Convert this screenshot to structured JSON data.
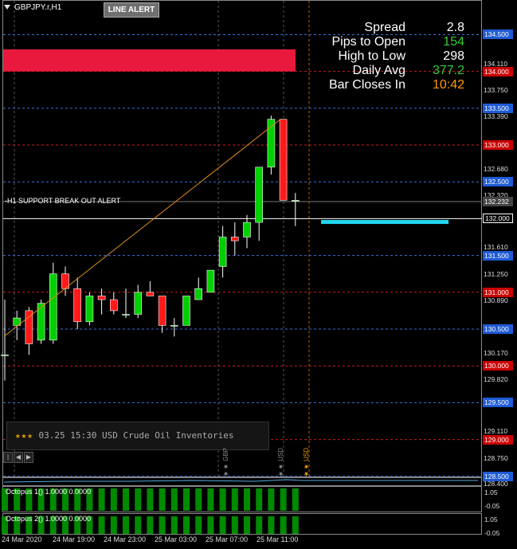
{
  "window": {
    "title": "GBPJPY.r,H1"
  },
  "toolbar": {
    "line_alert_label": "LINE ALERT"
  },
  "hud": {
    "rows": [
      {
        "label": "Spread",
        "value": "2.8",
        "color": "#ffffff"
      },
      {
        "label": "Pips to Open",
        "value": "154",
        "color": "#33cc33"
      },
      {
        "label": "High to Low",
        "value": "298",
        "color": "#ffffff"
      },
      {
        "label": "Daily Avg",
        "value": "377.2",
        "color": "#33cc33"
      },
      {
        "label": "Bar Closes In",
        "value": "10:42",
        "color": "#ff9900"
      }
    ]
  },
  "alert_line_label": "-H1 SUPPORT BREAK OUT ALERT",
  "news": {
    "stars": "★★★",
    "text": "03.25 15:30 USD Crude Oil Inventories"
  },
  "event_markers": [
    {
      "label": "GBP",
      "color": "#888888"
    },
    {
      "label": "USD",
      "color": "#888888"
    },
    {
      "label": "USD",
      "color": "#e8a000"
    }
  ],
  "price_axis": {
    "labels": [
      "134.110",
      "133.750",
      "133.390",
      "132.680",
      "132.320",
      "131.610",
      "131.250",
      "130.890",
      "130.170",
      "129.820",
      "129.110",
      "128.750",
      "128.400"
    ],
    "tags": [
      {
        "text": "134.500",
        "color": "#1e5bd6"
      },
      {
        "text": "134.000",
        "color": "#cc0000"
      },
      {
        "text": "133.500",
        "color": "#1e5bd6"
      },
      {
        "text": "133.000",
        "color": "#cc0000"
      },
      {
        "text": "132.500",
        "color": "#1e5bd6"
      },
      {
        "text": "132.232",
        "color": "#444444"
      },
      {
        "text": "132.000",
        "color": "#000000"
      },
      {
        "text": "131.500",
        "color": "#1e5bd6"
      },
      {
        "text": "131.000",
        "color": "#cc0000"
      },
      {
        "text": "130.500",
        "color": "#1e5bd6"
      },
      {
        "text": "130.000",
        "color": "#cc0000"
      },
      {
        "text": "129.500",
        "color": "#1e5bd6"
      },
      {
        "text": "129.000",
        "color": "#cc0000"
      },
      {
        "text": "128.500",
        "color": "#1e5bd6"
      }
    ]
  },
  "time_axis": [
    "24 Mar 2020",
    "24 Mar 19:00",
    "24 Mar 23:00",
    "25 Mar 03:00",
    "25 Mar 07:00",
    "25 Mar 11:00"
  ],
  "subwindows": [
    {
      "title": "Octopus 1() 1.0000 0.0000",
      "axis_top": "1.05",
      "axis_bottom": "-0.05"
    },
    {
      "title": "Octopus 2() 1.0000 0.0000",
      "axis_top": "1.05",
      "axis_bottom": "-0.05"
    }
  ],
  "chart_data": {
    "type": "candlestick",
    "symbol": "GBPJPY.r",
    "timeframe": "H1",
    "ylim": [
      128.4,
      134.7
    ],
    "candles": [
      {
        "o": 130.15,
        "h": 130.9,
        "l": 129.8,
        "c": 130.15
      },
      {
        "o": 130.55,
        "h": 130.75,
        "l": 130.35,
        "c": 130.65
      },
      {
        "o": 130.75,
        "h": 130.8,
        "l": 130.15,
        "c": 130.3
      },
      {
        "o": 130.35,
        "h": 130.9,
        "l": 130.3,
        "c": 130.85
      },
      {
        "o": 130.35,
        "h": 131.4,
        "l": 130.3,
        "c": 131.25
      },
      {
        "o": 131.25,
        "h": 131.35,
        "l": 130.95,
        "c": 131.05
      },
      {
        "o": 131.05,
        "h": 131.2,
        "l": 130.5,
        "c": 130.6
      },
      {
        "o": 130.6,
        "h": 131.0,
        "l": 130.55,
        "c": 130.95
      },
      {
        "o": 130.95,
        "h": 131.05,
        "l": 130.7,
        "c": 130.9
      },
      {
        "o": 130.9,
        "h": 131.0,
        "l": 130.7,
        "c": 130.75
      },
      {
        "o": 130.7,
        "h": 131.05,
        "l": 130.65,
        "c": 130.7
      },
      {
        "o": 130.7,
        "h": 131.1,
        "l": 130.65,
        "c": 131.0
      },
      {
        "o": 131.0,
        "h": 131.15,
        "l": 130.95,
        "c": 130.95
      },
      {
        "o": 130.95,
        "h": 130.95,
        "l": 130.45,
        "c": 130.55
      },
      {
        "o": 130.55,
        "h": 130.65,
        "l": 130.4,
        "c": 130.55
      },
      {
        "o": 130.55,
        "h": 130.95,
        "l": 130.55,
        "c": 130.95
      },
      {
        "o": 130.9,
        "h": 131.2,
        "l": 130.9,
        "c": 131.05
      },
      {
        "o": 131.0,
        "h": 131.3,
        "l": 131.0,
        "c": 131.3
      },
      {
        "o": 131.35,
        "h": 131.9,
        "l": 131.2,
        "c": 131.75
      },
      {
        "o": 131.75,
        "h": 131.95,
        "l": 131.5,
        "c": 131.7
      },
      {
        "o": 131.75,
        "h": 132.05,
        "l": 131.6,
        "c": 131.95
      },
      {
        "o": 131.95,
        "h": 132.4,
        "l": 131.7,
        "c": 132.7
      },
      {
        "o": 132.7,
        "h": 133.4,
        "l": 132.6,
        "c": 133.35
      },
      {
        "o": 133.35,
        "h": 133.35,
        "l": 132.3,
        "c": 132.25
      },
      {
        "o": 132.25,
        "h": 132.35,
        "l": 131.9,
        "c": 132.25
      }
    ],
    "levels": {
      "blue": [
        134.5,
        133.5,
        132.5,
        131.5,
        130.5,
        129.5,
        128.5
      ],
      "red": [
        134.0,
        133.0,
        131.0,
        130.0,
        129.0
      ]
    },
    "current_price": 132.232,
    "alert_line": 132.0,
    "red_zone": [
      134.0,
      134.3
    ],
    "cyan_zone": 131.95
  }
}
